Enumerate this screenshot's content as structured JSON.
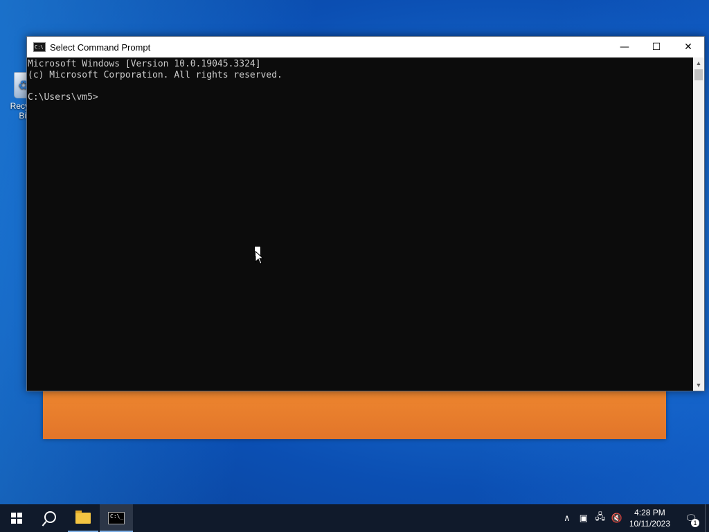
{
  "desktop": {
    "icons": [
      {
        "label": "Recycle Bin",
        "icon": "recycle-bin-icon"
      }
    ]
  },
  "window": {
    "title": "Select Command Prompt",
    "icon": "cmd-icon",
    "buttons": {
      "minimize": "—",
      "maximize": "☐",
      "close": "✕"
    },
    "console_lines": [
      "Microsoft Windows [Version 10.0.19045.3324]",
      "(c) Microsoft Corporation. All rights reserved.",
      "",
      "C:\\Users\\vm5>"
    ]
  },
  "taskbar": {
    "items": [
      {
        "name": "start",
        "icon": "windows-start-icon"
      },
      {
        "name": "search",
        "icon": "search-icon"
      },
      {
        "name": "file-explorer",
        "icon": "folder-icon"
      },
      {
        "name": "command-prompt",
        "icon": "cmd-icon",
        "active": true
      }
    ],
    "tray": {
      "chevron": "∧",
      "icons": [
        "security-icon",
        "network-icon",
        "volume-muted-icon"
      ],
      "time": "4:28 PM",
      "date": "10/11/2023",
      "notification_count": "1"
    }
  }
}
